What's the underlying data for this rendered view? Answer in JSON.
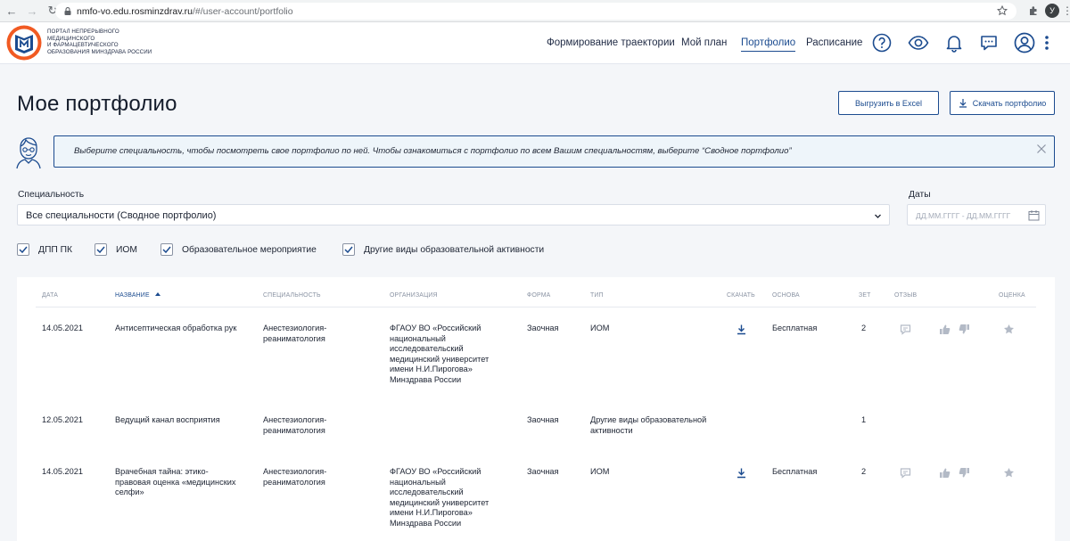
{
  "browser": {
    "url_host": "nmfo-vo.edu.rosminzdrav.ru",
    "url_path": "/#/user-account/portfolio",
    "profile_initial": "У"
  },
  "header": {
    "logo_lines": [
      "ПОРТАЛ НЕПРЕРЫВНОГО",
      "МЕДИЦИНСКОГО",
      "И ФАРМАЦЕВТИЧЕСКОГО",
      "ОБРАЗОВАНИЯ МИНЗДРАВА РОССИИ"
    ],
    "nav": [
      {
        "label": "Формирование траектории",
        "active": false
      },
      {
        "label": "Мой план",
        "active": false
      },
      {
        "label": "Портфолио",
        "active": true
      },
      {
        "label": "Расписание",
        "active": false
      }
    ],
    "icons": [
      "help-icon",
      "eye-icon",
      "bell-icon",
      "chat-icon",
      "user-icon",
      "more-icon"
    ]
  },
  "page": {
    "title": "Мое портфолио",
    "export_excel_label": "Выгрузить в Excel",
    "download_label": "Скачать портфолио"
  },
  "banner": {
    "text": "Выберите специальность, чтобы посмотреть свое портфолио по ней. Чтобы ознакомиться с портфолио по всем Вашим специальностям, выберите “Сводное портфолио”"
  },
  "filters": {
    "specialty_label": "Специальность",
    "specialty_value": "Все специальности (Сводное портфолио)",
    "dates_label": "Даты",
    "dates_placeholder": "ДД.ММ.ГГГГ - ДД.ММ.ГГГГ",
    "checkboxes": [
      {
        "label": "ДПП ПК",
        "checked": true
      },
      {
        "label": "ИОМ",
        "checked": true
      },
      {
        "label": "Образовательное мероприятие",
        "checked": true
      },
      {
        "label": "Другие виды образовательной активности",
        "checked": true
      }
    ]
  },
  "table": {
    "columns": [
      "ДАТА",
      "НАЗВАНИЕ",
      "СПЕЦИАЛЬНОСТЬ",
      "ОРГАНИЗАЦИЯ",
      "ФОРМА",
      "ТИП",
      "СКАЧАТЬ",
      "ОСНОВА",
      "ЗЕТ",
      "ОТЗЫВ",
      "ОЦЕНКА"
    ],
    "sorted_column": "НАЗВАНИЕ",
    "rows": [
      {
        "date": "14.05.2021",
        "name": "Антисептическая обработка рук",
        "specialty": "Анестезиология-\nреаниматология",
        "organization": "ФГАОУ ВО «Российский\nнациональный\nисследовательский\nмедицинский университет\nимени Н.И.Пирогова»\nМинздрава России",
        "form": "Заочная",
        "type": "ИОМ",
        "downloadable": true,
        "basis": "Бесплатная",
        "zet": "2",
        "has_actions": true
      },
      {
        "date": "12.05.2021",
        "name": "Ведущий канал восприятия",
        "specialty": "Анестезиология-\nреаниматология",
        "organization": "",
        "form": "Заочная",
        "type": "Другие виды образовательной\nактивности",
        "downloadable": false,
        "basis": "",
        "zet": "1",
        "has_actions": false
      },
      {
        "date": "14.05.2021",
        "name": "Врачебная тайна: этико-\nправовая оценка «медицинских\nселфи»",
        "specialty": "Анестезиология-\nреаниматология",
        "organization": "ФГАОУ ВО «Российский\nнациональный\nисследовательский\nмедицинский университет\nимени Н.И.Пирогова»\nМинздрава России",
        "form": "Заочная",
        "type": "ИОМ",
        "downloadable": true,
        "basis": "Бесплатная",
        "zet": "2",
        "has_actions": true
      }
    ]
  },
  "colors": {
    "accent": "#1b4b8f",
    "logo_orange": "#f15a22",
    "logo_blue": "#1b4b8f",
    "muted_icon": "#b3bac6",
    "banner_bg": "#eef5fa",
    "page_bg": "#f4f6f9"
  }
}
